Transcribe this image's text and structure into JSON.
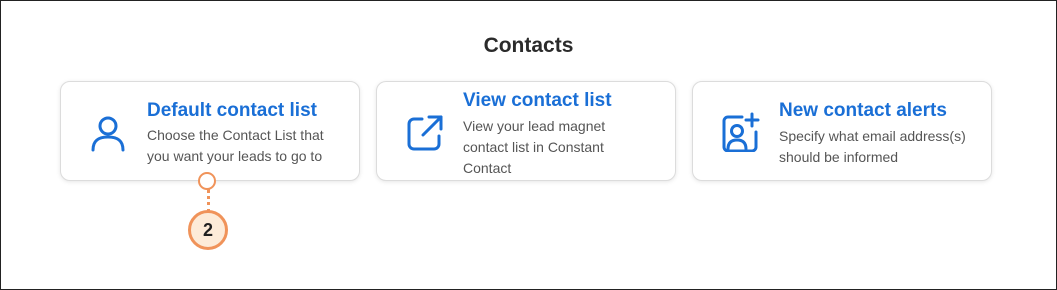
{
  "section": {
    "title": "Contacts"
  },
  "cards": [
    {
      "icon": "user-icon",
      "title": "Default contact list",
      "description": "Choose the Contact List that you want your leads to go to"
    },
    {
      "icon": "external-link-icon",
      "title": "View contact list",
      "description": "View your lead magnet contact list in Constant Contact"
    },
    {
      "icon": "add-contact-icon",
      "title": "New contact alerts",
      "description": "Specify what email address(s) should be informed"
    }
  ],
  "callout": {
    "number": "2"
  },
  "colors": {
    "accent": "#1a6fd6",
    "callout": "#f0935a",
    "callout_fill": "#fdebd8"
  }
}
